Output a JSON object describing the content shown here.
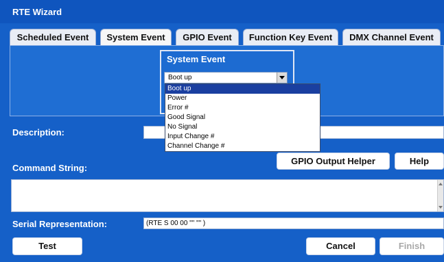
{
  "window": {
    "title": "RTE Wizard"
  },
  "tabs": [
    {
      "label": "Scheduled Event"
    },
    {
      "label": "System Event"
    },
    {
      "label": "GPIO Event"
    },
    {
      "label": "Function Key Event"
    },
    {
      "label": "DMX Channel Event"
    }
  ],
  "system_event": {
    "group_title": "System Event",
    "selected": "Boot up",
    "options": [
      "Boot up",
      "Power",
      "Error #",
      "Good Signal",
      "No Signal",
      "Input Change #",
      "Channel Change #"
    ]
  },
  "description": {
    "label": "Description:",
    "value": ""
  },
  "command": {
    "label": "Command String:",
    "gpio_button": "GPIO Output Helper",
    "help_button": "Help",
    "value": ""
  },
  "serial": {
    "label": "Serial Representation:",
    "value": "(RTE S 00 00 \"\" \"\" )"
  },
  "footer": {
    "test": "Test",
    "cancel": "Cancel",
    "finish": "Finish"
  },
  "colors": {
    "background": "#1560c8",
    "selected_option": "#1a3fa0"
  }
}
